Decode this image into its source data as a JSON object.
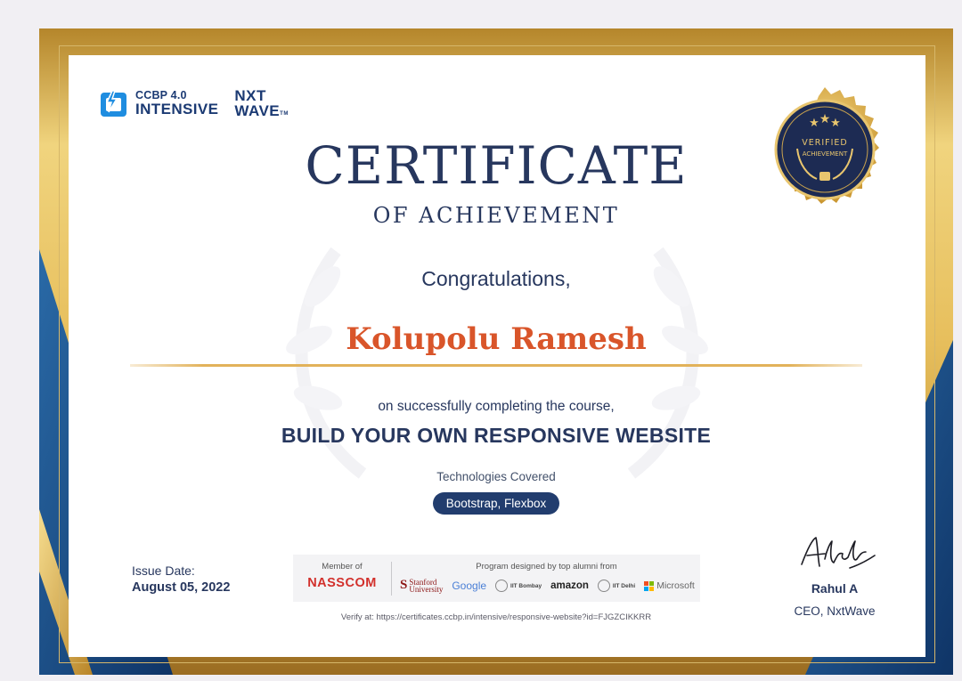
{
  "logos": {
    "ccbp_line1": "CCBP 4.0",
    "ccbp_line2": "INTENSIVE",
    "nxt_line1": "NXT",
    "nxt_line2": "WAVE",
    "nxt_tm": "TM"
  },
  "badge": {
    "line1": "VERIFIED",
    "line2": "ACHIEVEMENT"
  },
  "certificate": {
    "title": "CERTIFICATE",
    "subtitle": "OF ACHIEVEMENT",
    "greeting": "Congratulations,",
    "recipient_name": "Kolupolu Ramesh",
    "completion_text": "on successfully completing the course,",
    "course_name": "BUILD YOUR OWN RESPONSIVE WEBSITE",
    "technologies_label": "Technologies Covered",
    "technologies": "Bootstrap, Flexbox"
  },
  "issue": {
    "label": "Issue Date:",
    "date": "August 05, 2022"
  },
  "partners": {
    "member_label": "Member of",
    "member_name": "NASSCOM",
    "designed_label": "Program designed by top alumni from",
    "stanford_line1": "Stanford",
    "stanford_line2": "University",
    "google": "Google",
    "iit_bombay": "IIT Bombay",
    "amazon": "amazon",
    "iit_delhi": "IIT Delhi",
    "microsoft": "Microsoft"
  },
  "verify_text": "Verify at: https://certificates.ccbp.in/intensive/responsive-website?id=FJGZCIKKRR",
  "signatory": {
    "name": "Rahul A",
    "role": "CEO, NxtWave"
  },
  "colors": {
    "navy": "#27375e",
    "accent_orange": "#d9552a",
    "gold": "#e2b25a",
    "pill_bg": "#223d6e",
    "frame_navy": "#1d4f8a"
  }
}
